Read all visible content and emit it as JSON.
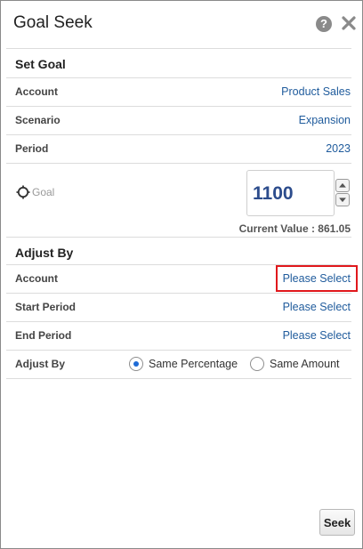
{
  "dialog": {
    "title": "Goal Seek",
    "help_symbol": "?",
    "icons": {
      "help": "help-icon",
      "close": "close-icon",
      "goal": "target-icon"
    }
  },
  "set_goal": {
    "title": "Set Goal",
    "account": {
      "label": "Account",
      "value": "Product Sales"
    },
    "scenario": {
      "label": "Scenario",
      "value": "Expansion"
    },
    "period": {
      "label": "Period",
      "value": "2023"
    },
    "goal": {
      "label": "Goal",
      "value": "1100"
    },
    "current_value": "Current Value : 861.05"
  },
  "adjust_by": {
    "title": "Adjust By",
    "account": {
      "label": "Account",
      "value": "Please Select"
    },
    "start_period": {
      "label": "Start Period",
      "value": "Please Select"
    },
    "end_period": {
      "label": "End Period",
      "value": "Please Select"
    },
    "adjust_by": {
      "label": "Adjust By",
      "options": [
        {
          "label": "Same Percentage",
          "selected": true
        },
        {
          "label": "Same Amount",
          "selected": false
        }
      ]
    }
  },
  "footer": {
    "seek_label": "Seek"
  },
  "colors": {
    "link": "#1f5b9c",
    "highlight": "#e0181c",
    "radio_selected": "#1e6bd6"
  }
}
